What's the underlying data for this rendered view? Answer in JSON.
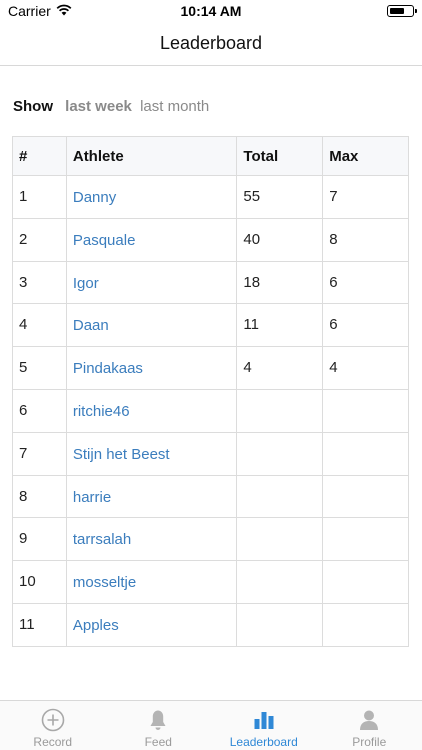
{
  "status_bar": {
    "carrier": "Carrier",
    "time": "10:14 AM"
  },
  "nav": {
    "title": "Leaderboard"
  },
  "filter": {
    "label": "Show",
    "options": [
      "last week",
      "last month"
    ],
    "selected": "last week"
  },
  "table": {
    "headers": [
      "#",
      "Athlete",
      "Total",
      "Max"
    ],
    "rows": [
      {
        "rank": "1",
        "athlete": "Danny",
        "total": "55",
        "max": "7"
      },
      {
        "rank": "2",
        "athlete": "Pasquale",
        "total": "40",
        "max": "8"
      },
      {
        "rank": "3",
        "athlete": "Igor",
        "total": "18",
        "max": "6"
      },
      {
        "rank": "4",
        "athlete": "Daan",
        "total": "11",
        "max": "6"
      },
      {
        "rank": "5",
        "athlete": "Pindakaas",
        "total": "4",
        "max": "4"
      },
      {
        "rank": "6",
        "athlete": "ritchie46",
        "total": "",
        "max": ""
      },
      {
        "rank": "7",
        "athlete": "Stijn het Beest",
        "total": "",
        "max": ""
      },
      {
        "rank": "8",
        "athlete": "harrie",
        "total": "",
        "max": ""
      },
      {
        "rank": "9",
        "athlete": "tarrsalah",
        "total": "",
        "max": ""
      },
      {
        "rank": "10",
        "athlete": "mosseltje",
        "total": "",
        "max": ""
      },
      {
        "rank": "11",
        "athlete": "Apples",
        "total": "",
        "max": ""
      }
    ]
  },
  "tab_bar": {
    "tabs": [
      {
        "label": "Record",
        "icon": "plus-circle-icon"
      },
      {
        "label": "Feed",
        "icon": "bell-icon"
      },
      {
        "label": "Leaderboard",
        "icon": "bar-chart-icon"
      },
      {
        "label": "Profile",
        "icon": "person-icon"
      }
    ],
    "active": "Leaderboard"
  },
  "colors": {
    "accent": "#2f88d6",
    "link": "#3b7dbd",
    "inactive": "#9a9a9a"
  }
}
